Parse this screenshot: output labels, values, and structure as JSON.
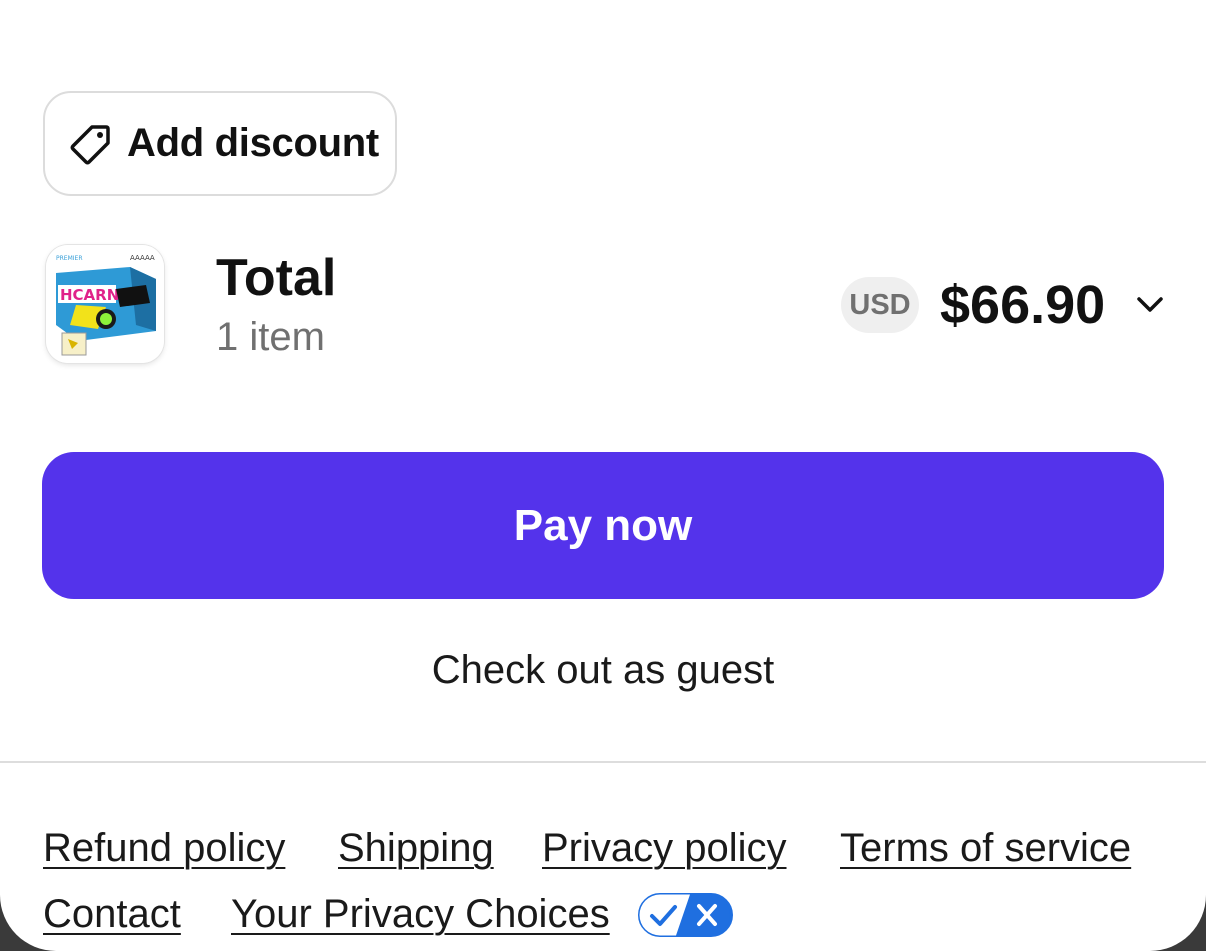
{
  "discount": {
    "label": "Add discount",
    "icon": "tag-icon"
  },
  "order": {
    "title": "Total",
    "item_count": "1 item",
    "currency": "USD",
    "amount": "$66.90",
    "product_thumbnail": "product-box-image",
    "expand_icon": "chevron-down-icon"
  },
  "actions": {
    "pay_label": "Pay now",
    "guest_label": "Check out as guest"
  },
  "footer": {
    "refund": "Refund policy",
    "shipping": "Shipping",
    "privacy": "Privacy policy",
    "terms": "Terms of service",
    "contact": "Contact",
    "privacy_choices": "Your Privacy Choices",
    "privacy_choices_icon": "privacy-options-toggle-icon"
  },
  "colors": {
    "accent": "#5433eb",
    "privacy_blue": "#1f6fe0"
  }
}
